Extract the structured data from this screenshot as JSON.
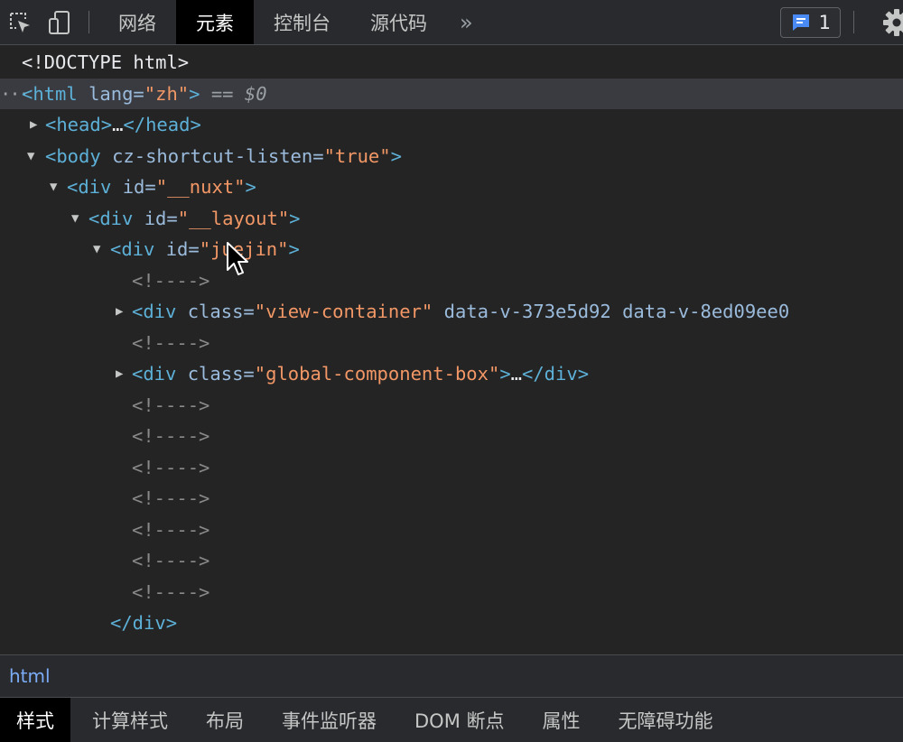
{
  "toolbar": {
    "tabs": [
      {
        "label": "网络",
        "active": false
      },
      {
        "label": "元素",
        "active": true
      },
      {
        "label": "控制台",
        "active": false
      },
      {
        "label": "源代码",
        "active": false
      }
    ],
    "more_label": "»",
    "issues_count": "1",
    "icons": [
      "inspect-icon",
      "device-toggle-icon",
      "issues-icon",
      "gear-icon"
    ]
  },
  "dom": {
    "doctype": "<!DOCTYPE html>",
    "html_open": {
      "tag": "<html",
      "attr": "lang=",
      "val": "\"zh\"",
      "close": ">",
      "eq": "==",
      "sel": "$0"
    },
    "head": {
      "open": "<head>",
      "ellipsis": "…",
      "close": "</head>"
    },
    "body": {
      "tag": "<body",
      "attr": "cz-shortcut-listen=",
      "val": "\"true\"",
      "close": ">"
    },
    "nuxt": {
      "tag": "<div",
      "attr": "id=",
      "val": "\"__nuxt\"",
      "close": ">"
    },
    "layout": {
      "tag": "<div",
      "attr": "id=",
      "val": "\"__layout\"",
      "close": ">"
    },
    "juejin": {
      "tag": "<div",
      "attr": "id=",
      "val": "\"juejin\"",
      "close": ">"
    },
    "comment": "<!---->",
    "view": {
      "tag": "<div",
      "attr": "class=",
      "val": "\"view-container\"",
      "extra": "data-v-373e5d92 data-v-8ed09ee0"
    },
    "global": {
      "tag": "<div",
      "attr": "class=",
      "val": "\"global-component-box\"",
      "close": ">",
      "ellipsis": "…",
      "end": "</div>"
    },
    "div_close": "</div>"
  },
  "colors": {
    "tag": "#5db0d7",
    "attr": "#9bbbdc",
    "value": "#f29766",
    "comment": "#898989",
    "accent": "#7cacf8"
  },
  "breadcrumb": {
    "items": [
      "html"
    ]
  },
  "bottom_tabs": [
    {
      "label": "样式",
      "active": true
    },
    {
      "label": "计算样式",
      "active": false
    },
    {
      "label": "布局",
      "active": false
    },
    {
      "label": "事件监听器",
      "active": false
    },
    {
      "label": "DOM 断点",
      "active": false
    },
    {
      "label": "属性",
      "active": false
    },
    {
      "label": "无障碍功能",
      "active": false
    }
  ]
}
